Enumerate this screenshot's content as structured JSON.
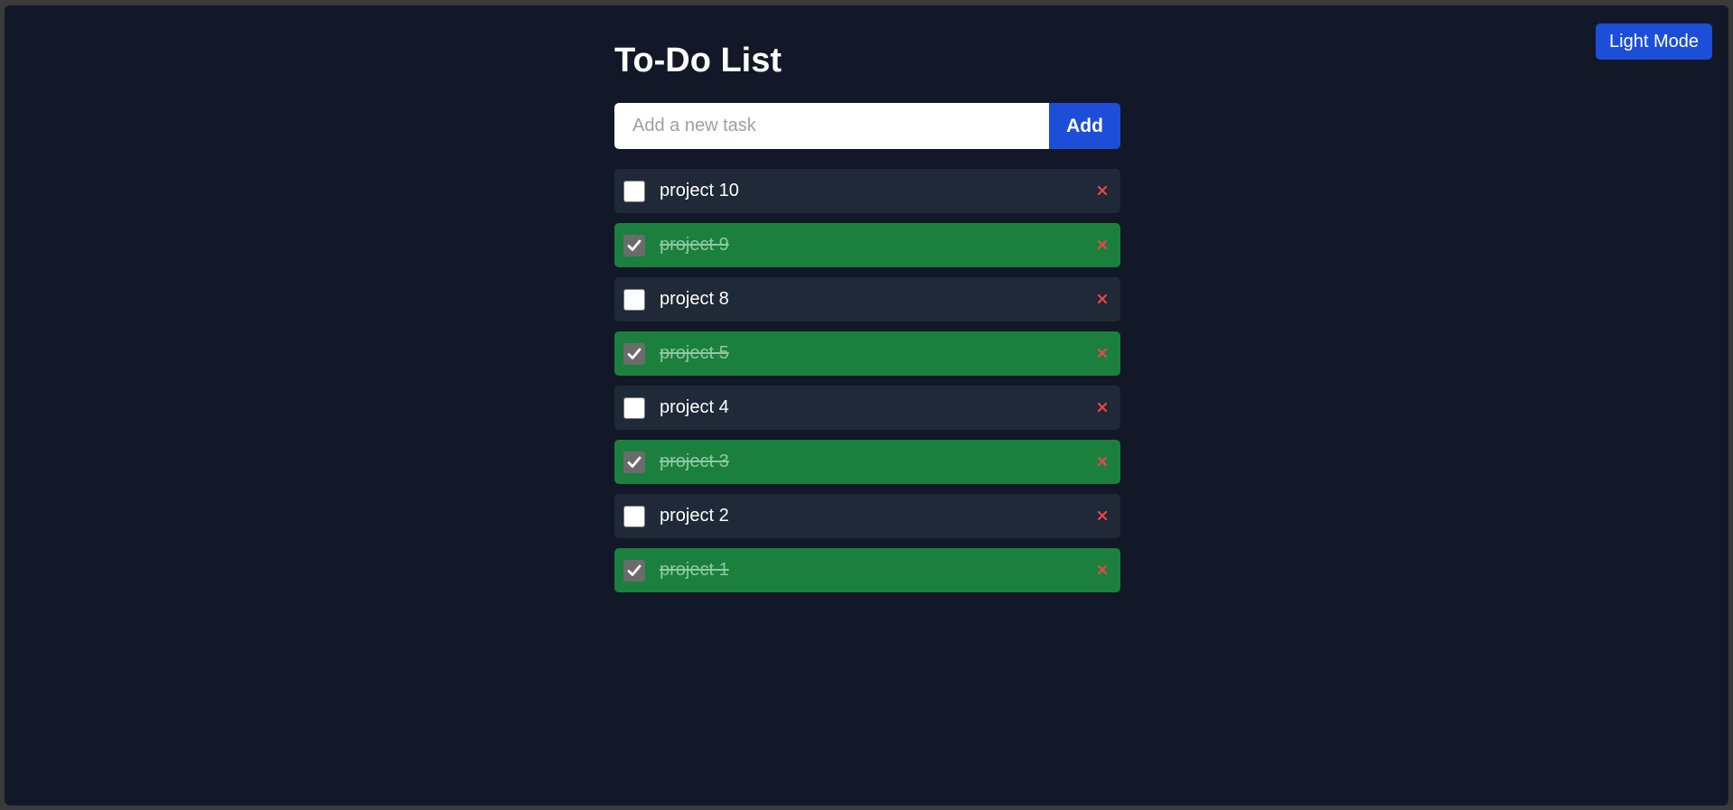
{
  "header": {
    "theme_toggle_label": "Light Mode",
    "title": "To-Do List"
  },
  "add_form": {
    "input_placeholder": "Add a new task",
    "input_value": "",
    "add_label": "Add"
  },
  "tasks": [
    {
      "label": "project 10",
      "completed": false
    },
    {
      "label": "project 9",
      "completed": true
    },
    {
      "label": "project 8",
      "completed": false
    },
    {
      "label": "project 5",
      "completed": true
    },
    {
      "label": "project 4",
      "completed": false
    },
    {
      "label": "project 3",
      "completed": true
    },
    {
      "label": "project 2",
      "completed": false
    },
    {
      "label": "project 1",
      "completed": true
    }
  ],
  "icons": {
    "checkbox": "checkmark-icon",
    "delete": "close-icon"
  },
  "colors": {
    "background": "#121827",
    "accent": "#1d4ed8",
    "task_pending": "#1f2937",
    "task_done": "#1b803e",
    "delete": "#ef4444"
  }
}
